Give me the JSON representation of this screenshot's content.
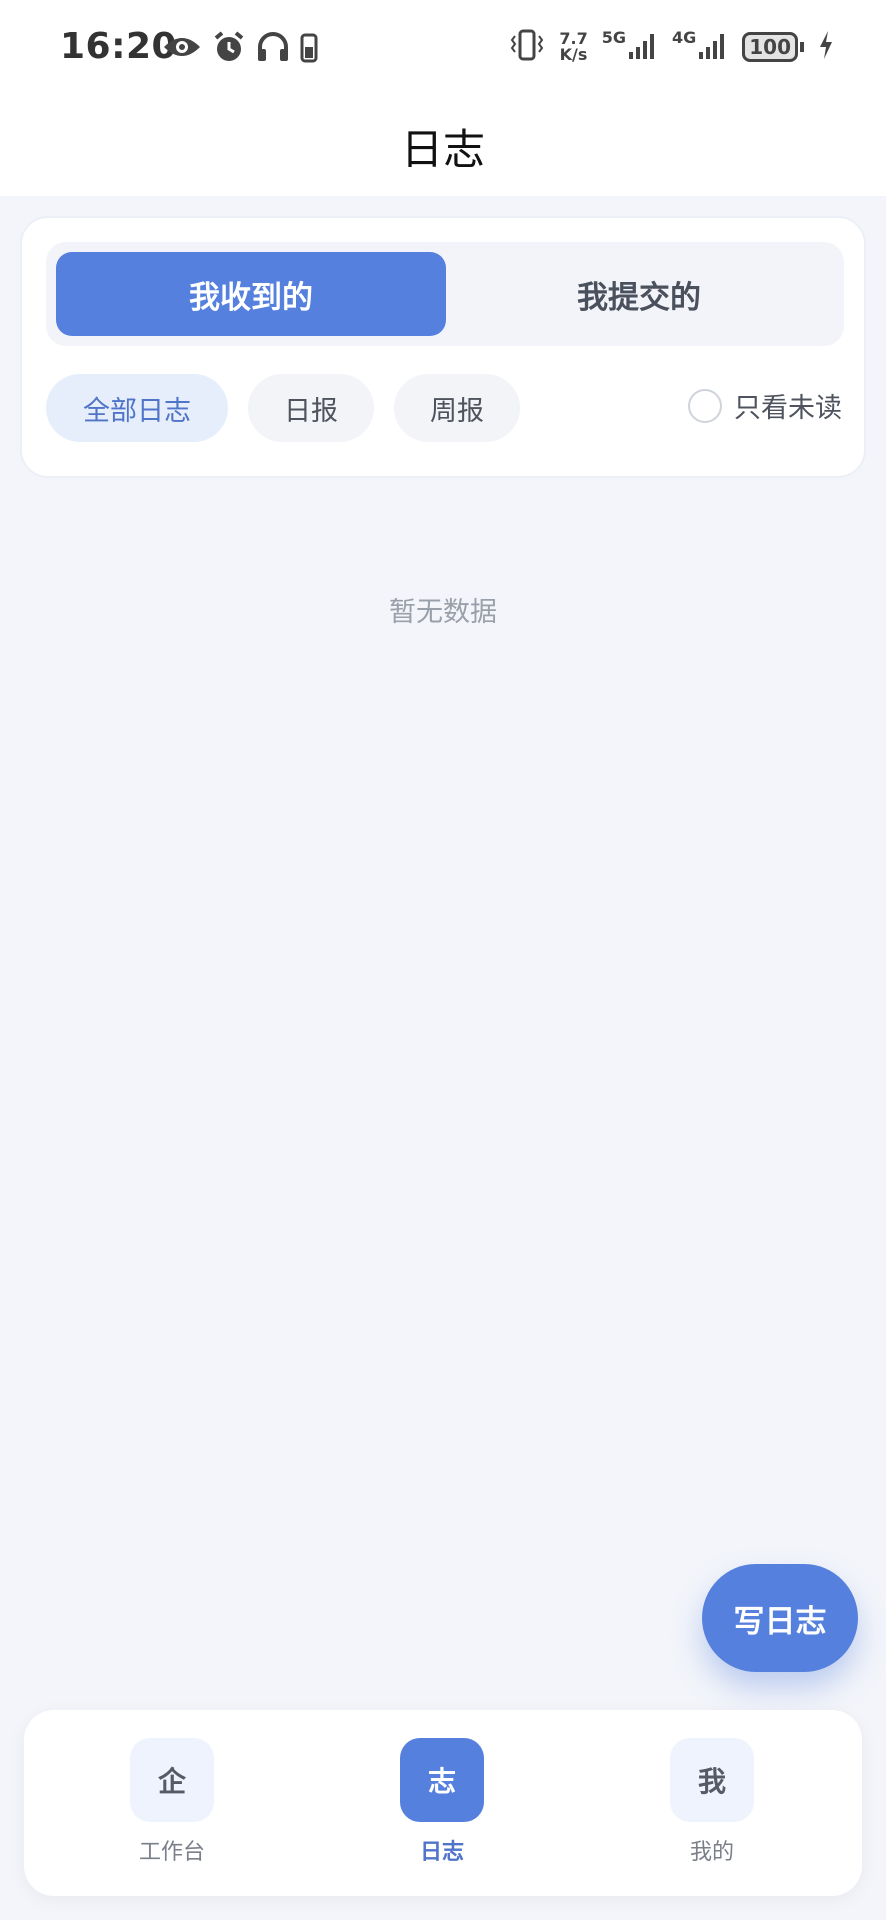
{
  "status_bar": {
    "time": "16:20",
    "speed_top": "7.7",
    "speed_bottom": "K/s",
    "net1": "5G",
    "net2": "4G",
    "battery": "100",
    "left_icons": [
      "eye-icon",
      "alarm-icon",
      "headphones-icon",
      "phone-battery-icon"
    ],
    "right_icons": [
      "vibrate-icon",
      "signal-icon",
      "charging-icon"
    ]
  },
  "header": {
    "title": "日志"
  },
  "segment": {
    "received": "我收到的",
    "submitted": "我提交的"
  },
  "filters": {
    "all": "全部日志",
    "daily": "日报",
    "weekly": "周报",
    "unread_only": "只看未读"
  },
  "empty_text": "暂无数据",
  "fab_label": "写日志",
  "tabbar": {
    "workbench": {
      "icon_char": "企",
      "label": "工作台"
    },
    "log": {
      "icon_char": "志",
      "label": "日志"
    },
    "mine": {
      "icon_char": "我",
      "label": "我的"
    }
  },
  "colors": {
    "accent": "#5580de",
    "chip_active_bg": "#e7eefb",
    "background": "#f3f5fa"
  }
}
